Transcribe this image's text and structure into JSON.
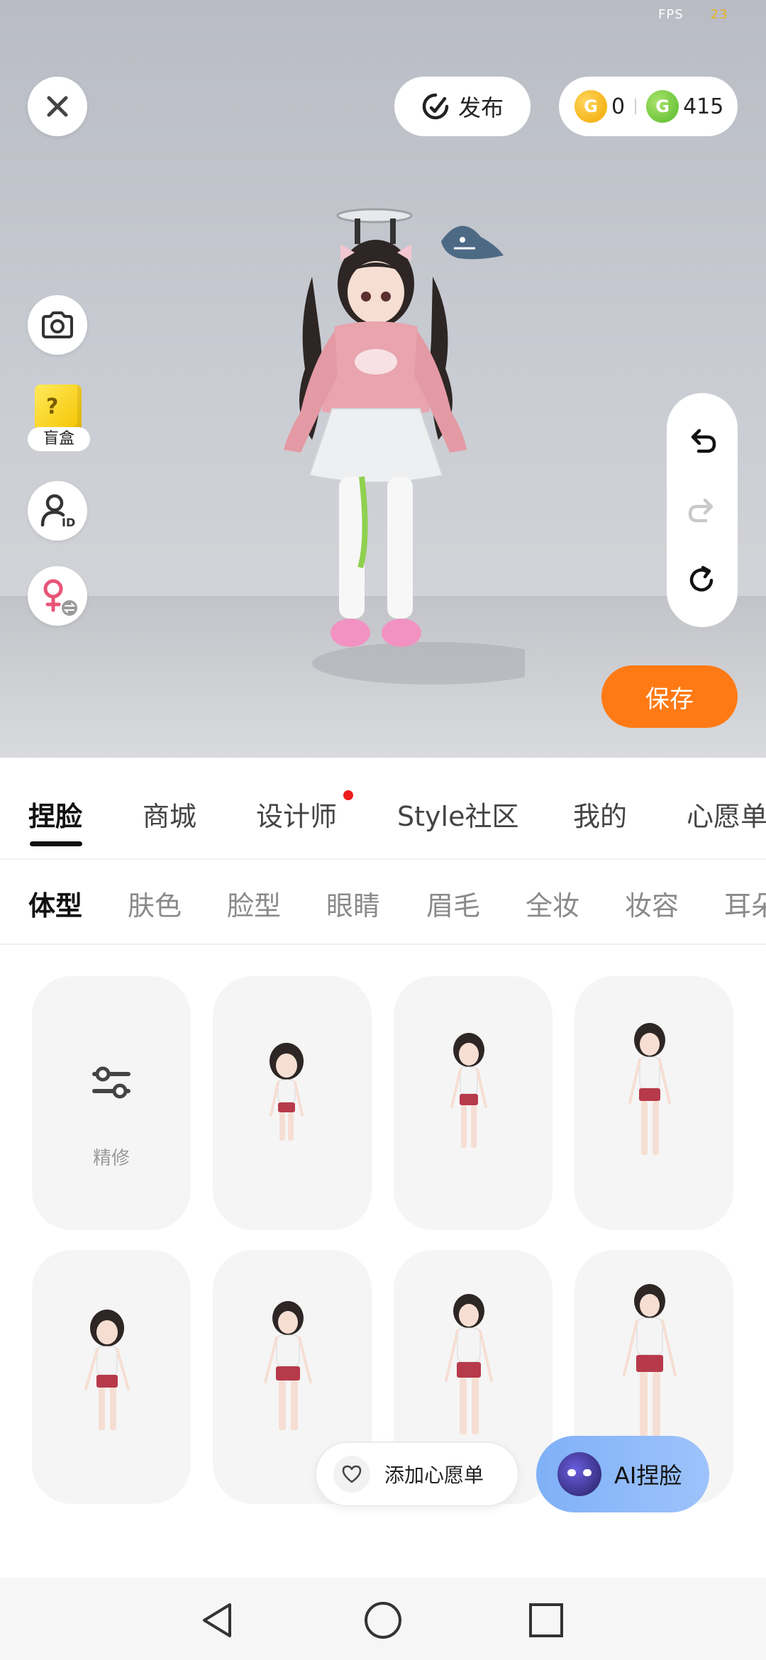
{
  "status": {
    "fps_label": "FPS",
    "fps_value": "23"
  },
  "top_bar": {
    "publish_label": "发布",
    "gold_amount": "0",
    "green_amount": "415"
  },
  "left_tools": {
    "blind_box_label": "盲盒"
  },
  "actions": {
    "save_label": "保存"
  },
  "main_tabs": [
    {
      "label": "捏脸",
      "active": true
    },
    {
      "label": "商城",
      "active": false
    },
    {
      "label": "设计师",
      "active": false,
      "has_dot": true
    },
    {
      "label": "Style社区",
      "active": false
    },
    {
      "label": "我的",
      "active": false
    },
    {
      "label": "心愿单",
      "active": false
    }
  ],
  "sub_tabs": [
    {
      "label": "体型",
      "active": true
    },
    {
      "label": "肤色",
      "active": false
    },
    {
      "label": "脸型",
      "active": false
    },
    {
      "label": "眼睛",
      "active": false
    },
    {
      "label": "眉毛",
      "active": false
    },
    {
      "label": "全妆",
      "active": false
    },
    {
      "label": "妆容",
      "active": false
    },
    {
      "label": "耳朵",
      "active": false
    }
  ],
  "grid": {
    "refine_label": "精修",
    "items": [
      {
        "icon": "refine-sliders-icon"
      },
      {
        "icon": "body-type-preview"
      },
      {
        "icon": "body-type-preview"
      },
      {
        "icon": "body-type-preview"
      },
      {
        "icon": "body-type-preview"
      },
      {
        "icon": "body-type-preview"
      },
      {
        "icon": "body-type-preview"
      },
      {
        "icon": "body-type-preview"
      }
    ]
  },
  "floating": {
    "wishlist_label": "添加心愿单",
    "ai_label": "AI捏脸"
  },
  "colors": {
    "accent_orange": "#ff7a14",
    "notify_red": "#ee1c1c",
    "ai_blue": "#8ab8f8"
  }
}
